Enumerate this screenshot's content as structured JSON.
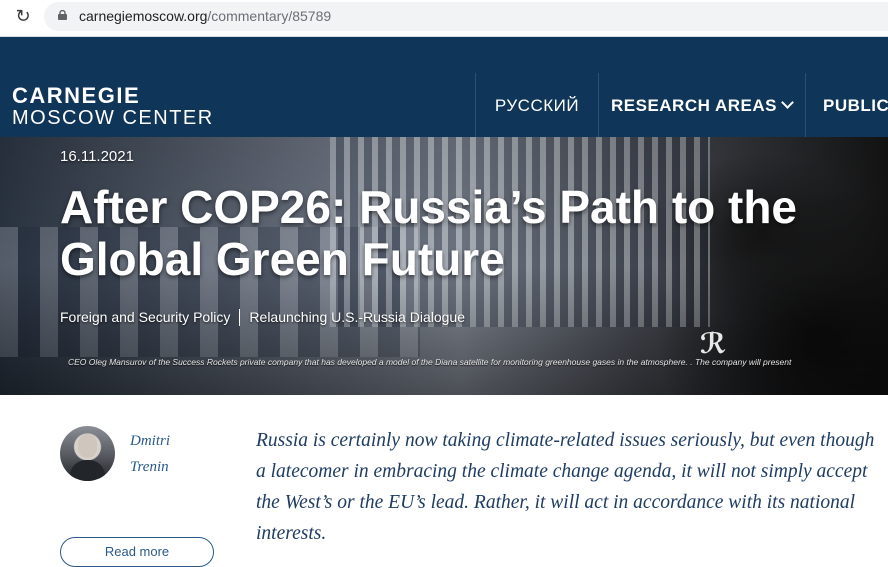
{
  "browser": {
    "reload_icon": "reload-icon",
    "lock_icon": "lock-icon",
    "url_domain": "carnegiemoscow.org",
    "url_path": "/commentary/85789"
  },
  "header": {
    "logo_line1": "CARNEGIE",
    "logo_line2": "MOSCOW CENTER",
    "nav": [
      {
        "label": "РУССКИЙ"
      },
      {
        "label": "RESEARCH AREAS"
      },
      {
        "label": "PUBLICA"
      }
    ],
    "colors": {
      "brand_navy": "#0f3558",
      "link_blue": "#2a5a8a"
    }
  },
  "hero": {
    "date": "16.11.2021",
    "title": "After COP26: Russia’s Path to the Global Green Future",
    "tags": [
      "Foreign and Security Policy",
      "Relaunching U.S.-Russia Dialogue"
    ],
    "caption": "CEO Oleg Mansurov of the Success Rockets private company that has developed a model of the Diana satellite for monitoring greenhouse gases in the atmosphere. . The company will present"
  },
  "author": {
    "name_line1": "Dmitri",
    "name_line2": "Trenin",
    "button_label": "Read more"
  },
  "lead": "Russia is certainly now taking climate-related issues seriously, but even though a latecomer in embracing the climate change agenda, it will not simply accept the West’s or the EU’s lead. Rather, it will act in accordance with its national interests."
}
